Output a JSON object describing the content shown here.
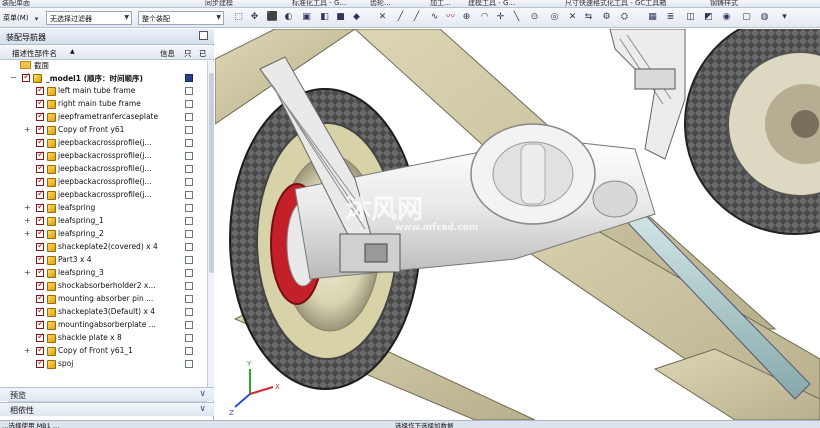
{
  "menubar": {
    "items": [
      "装配单面",
      "同步建模",
      "标准化工具 - G...",
      "齿轮...",
      "加工...",
      "建模工具 - G...",
      "尺寸快速格式化工具 - GC工具箱",
      "钢铸样式"
    ]
  },
  "toolbar": {
    "menu_label": "菜单(M)",
    "filter_value": "无选择过滤器",
    "scope_value": "整个装配"
  },
  "navigator": {
    "title": "装配导航器",
    "col_name": "描述性部件名",
    "col_info": "信息",
    "col_readonly": "只",
    "col_modified": "已",
    "rows": [
      {
        "label": "截面"
      },
      {
        "label": "_model1 (顺序：时间顺序)"
      },
      {
        "label": "left main tube frame"
      },
      {
        "label": "right main tube frame"
      },
      {
        "label": "jeepframetranfercaseplate"
      },
      {
        "label": "Copy of Front y61"
      },
      {
        "label": "jeepbackacrossprofile(j..."
      },
      {
        "label": "jeepbackacrossprofile(j..."
      },
      {
        "label": "jeepbackacrossprofile(j..."
      },
      {
        "label": "jeepbackacrossprofile(j..."
      },
      {
        "label": "jeepbackacrossprofile(j..."
      },
      {
        "label": "leafspring"
      },
      {
        "label": "leafspring_1"
      },
      {
        "label": "leafspring_2"
      },
      {
        "label": "shackeplate2(covered) x 4"
      },
      {
        "label": "Part3 x 4"
      },
      {
        "label": "leafspring_3"
      },
      {
        "label": "shockabsorberholder2 x..."
      },
      {
        "label": "mounting absorber pin ..."
      },
      {
        "label": "shackeplate3(Default) x 4"
      },
      {
        "label": "mountingabsorberplate ..."
      },
      {
        "label": "shackle plate x 8"
      },
      {
        "label": "Copy of Front y61_1"
      },
      {
        "label": "spoj"
      }
    ],
    "preview_label": "预览",
    "dependency_label": "相依性"
  },
  "statusbar": {
    "left": "…选择使用 MB1 …",
    "right": "选择作下选择加数据"
  },
  "watermark": {
    "line1": "沐风网",
    "line2": "www.mfcad.com"
  }
}
